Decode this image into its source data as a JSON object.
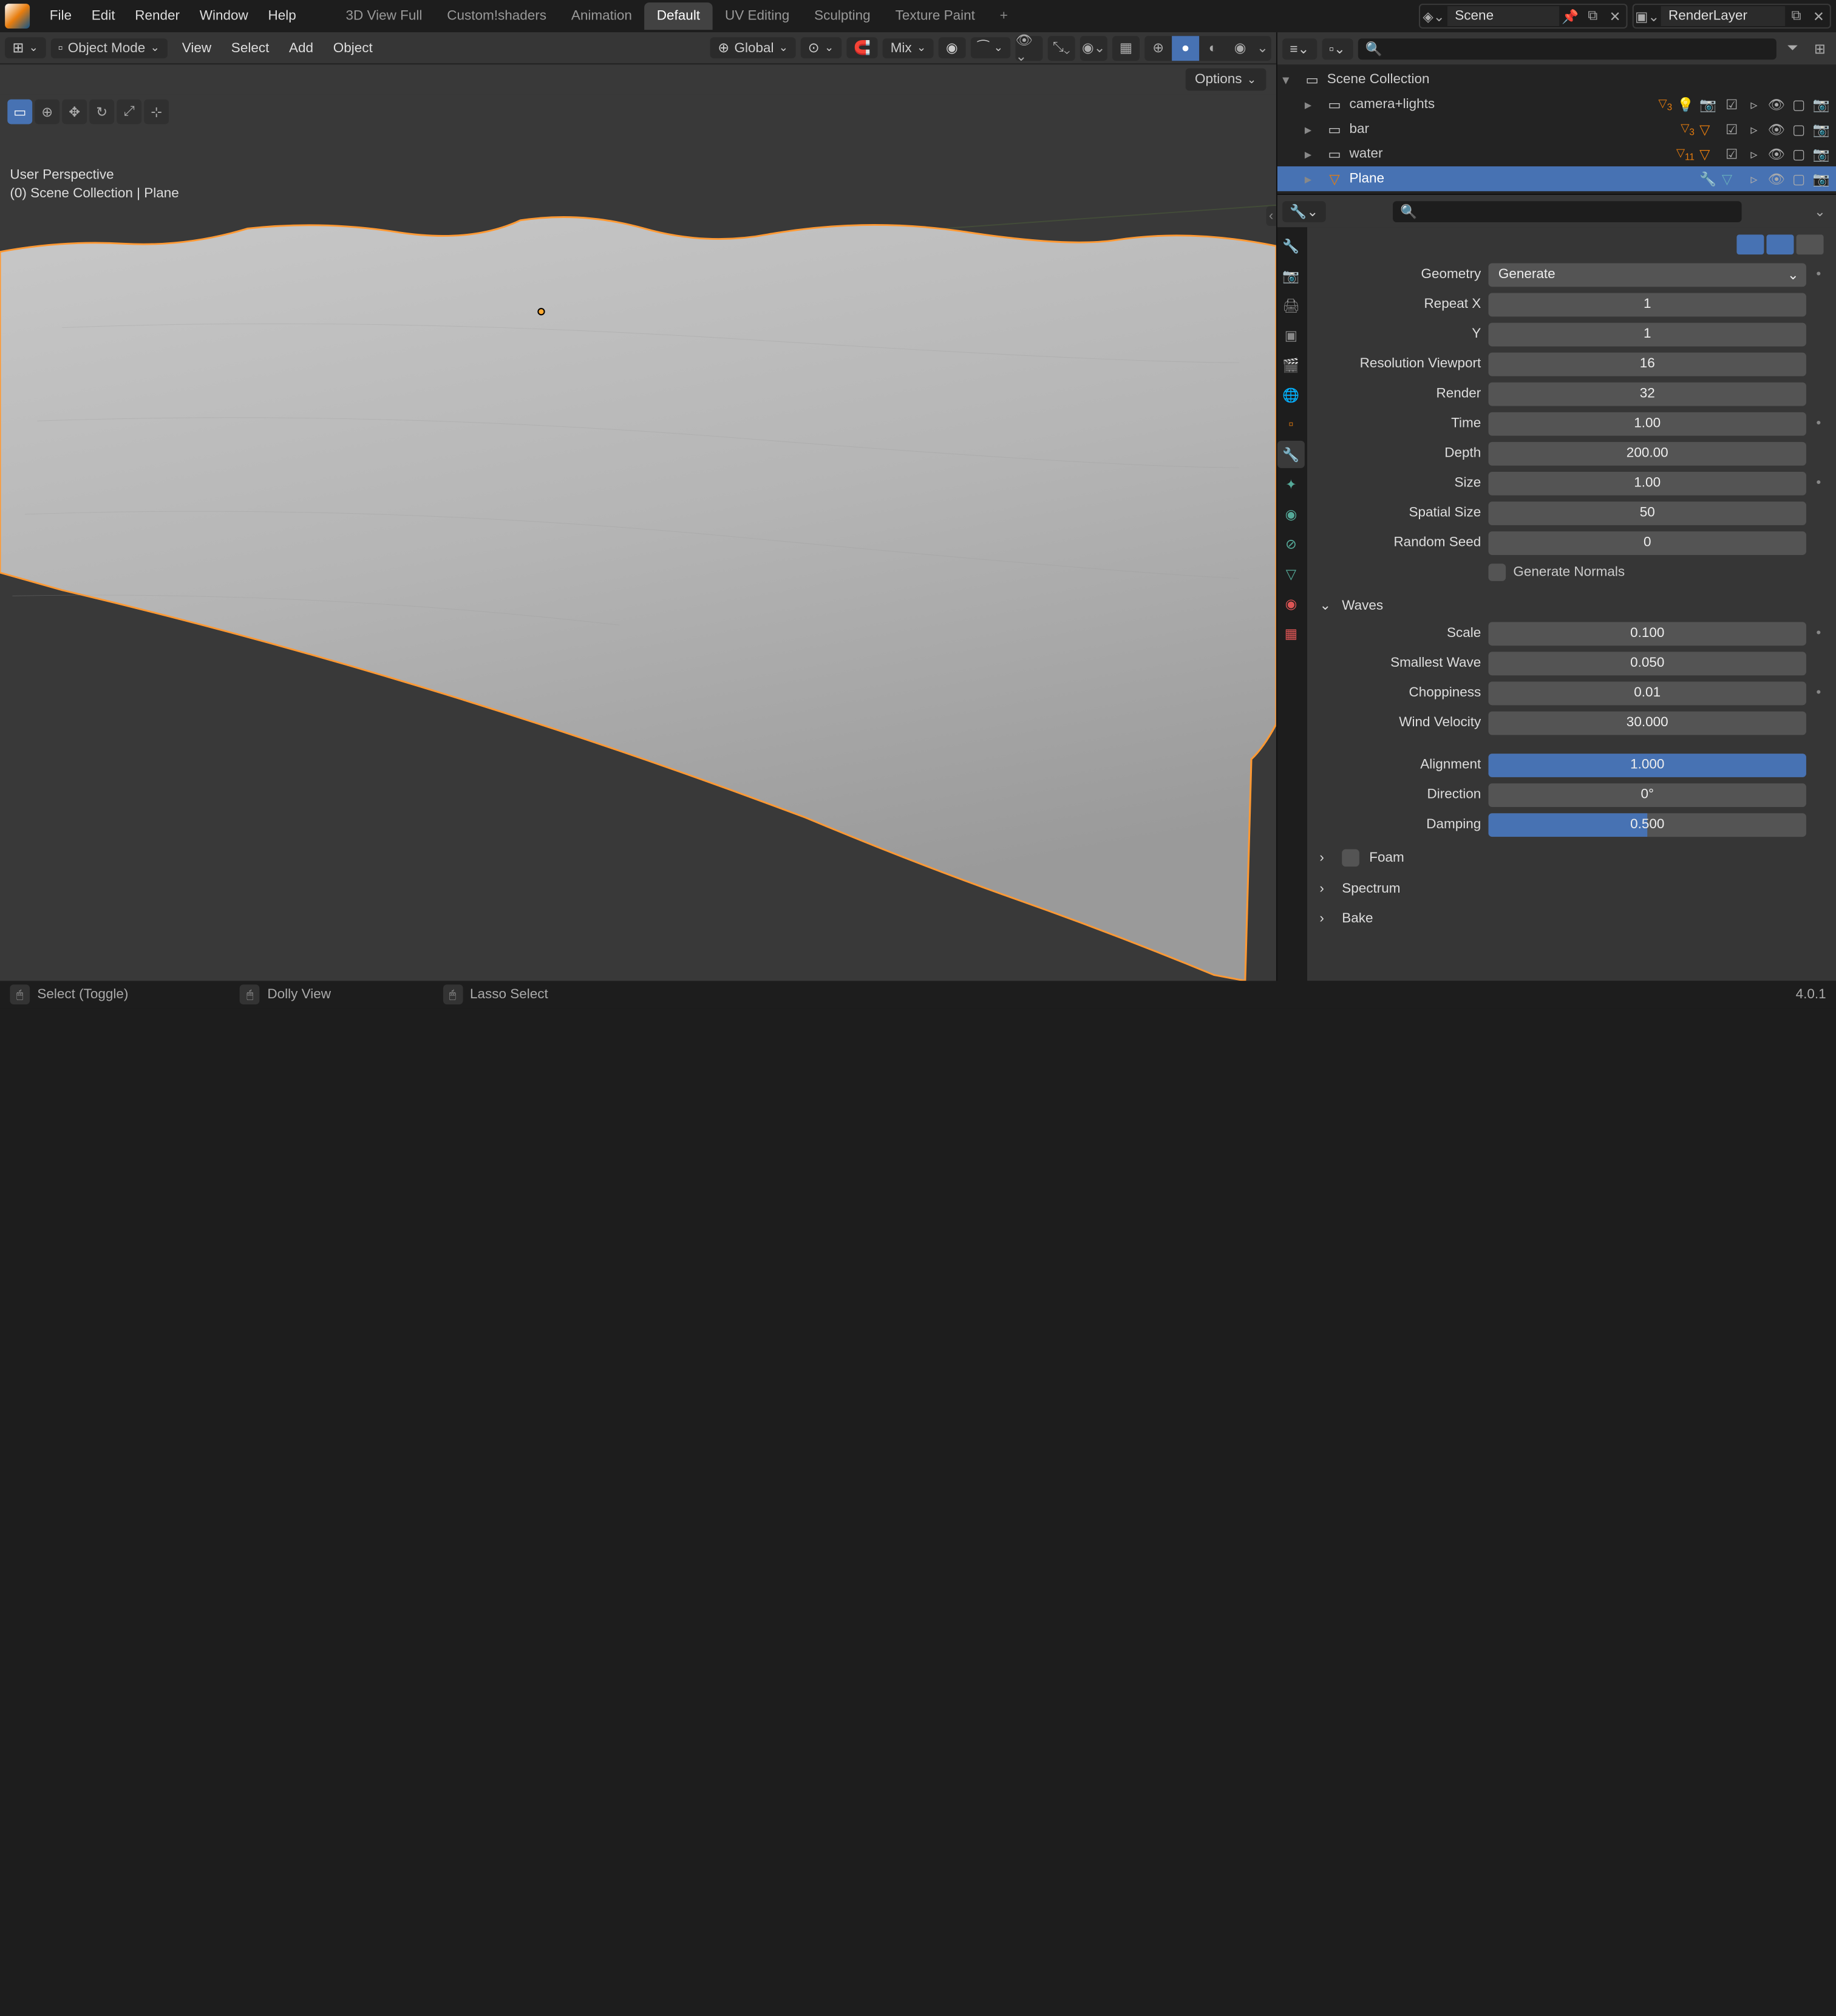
{
  "menubar": {
    "items": [
      "File",
      "Edit",
      "Render",
      "Window",
      "Help"
    ],
    "workspaces": [
      "3D View Full",
      "Custom!shaders",
      "Animation",
      "Default",
      "UV Editing",
      "Sculpting",
      "Texture Paint"
    ],
    "active_workspace": 3,
    "scene_name": "Scene",
    "layer_name": "RenderLayer"
  },
  "viewport": {
    "mode": "Object Mode",
    "menus": [
      "View",
      "Select",
      "Add",
      "Object"
    ],
    "orientation": "Global",
    "snap": "Mix",
    "options_label": "Options",
    "info_line1": "User Perspective",
    "info_line2": "(0) Scene Collection | Plane"
  },
  "outliner": {
    "root": "Scene Collection",
    "items": [
      {
        "name": "camera+lights",
        "type": "collection",
        "badge": "3",
        "extras": [
          "light",
          "camera"
        ]
      },
      {
        "name": "bar",
        "type": "collection",
        "badge": "3",
        "extras": [
          "mesh"
        ]
      },
      {
        "name": "water",
        "type": "collection",
        "badge": "11",
        "extras": [
          "mesh"
        ]
      },
      {
        "name": "Plane",
        "type": "object",
        "selected": true,
        "extras": [
          "modifier",
          "material"
        ]
      }
    ]
  },
  "properties": {
    "geometry_label": "Geometry",
    "geometry_value": "Generate",
    "rows": [
      {
        "label": "Repeat X",
        "value": "1"
      },
      {
        "label": "Y",
        "value": "1"
      },
      {
        "label": "Resolution Viewport",
        "value": "16"
      },
      {
        "label": "Render",
        "value": "32"
      },
      {
        "label": "Time",
        "value": "1.00",
        "dot": true
      },
      {
        "label": "Depth",
        "value": "200.00"
      },
      {
        "label": "Size",
        "value": "1.00",
        "dot": true
      },
      {
        "label": "Spatial Size",
        "value": "50"
      },
      {
        "label": "Random Seed",
        "value": "0"
      }
    ],
    "generate_normals": "Generate Normals",
    "waves_label": "Waves",
    "waves_rows": [
      {
        "label": "Scale",
        "value": "0.100",
        "dot": true
      },
      {
        "label": "Smallest Wave",
        "value": "0.050"
      },
      {
        "label": "Choppiness",
        "value": "0.01",
        "dot": true
      },
      {
        "label": "Wind Velocity",
        "value": "30.000"
      }
    ],
    "alignment_label": "Alignment",
    "alignment_value": "1.000",
    "direction_label": "Direction",
    "direction_value": "0°",
    "damping_label": "Damping",
    "damping_value": "0.500",
    "collapsed": [
      "Foam",
      "Spectrum",
      "Bake"
    ]
  },
  "statusbar": {
    "items": [
      "Select (Toggle)",
      "Dolly View",
      "Lasso Select"
    ],
    "version": "4.0.1"
  }
}
